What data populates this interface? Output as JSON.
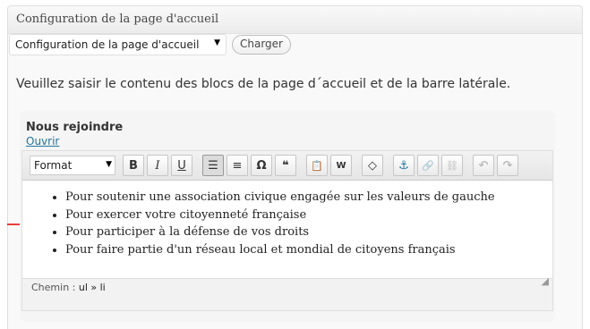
{
  "panel": {
    "title": "Configuration de la page d'accueil"
  },
  "loader": {
    "selected": "Configuration de la page d'accueil",
    "load_label": "Charger"
  },
  "intro_text": "Veuillez saisir le contenu des blocs de la page d´accueil et de la barre latérale.",
  "block": {
    "title": "Nous rejoindre",
    "open_link": "Ouvrir",
    "editor": {
      "format_label": "Format",
      "toolbar": [
        {
          "name": "bold",
          "glyph": "B"
        },
        {
          "name": "italic",
          "glyph": "I"
        },
        {
          "name": "underline",
          "glyph": "U"
        },
        {
          "name": "bullet-list",
          "glyph": "☰"
        },
        {
          "name": "numbered-list",
          "glyph": "≡"
        },
        {
          "name": "special-char",
          "glyph": "Ω"
        },
        {
          "name": "blockquote",
          "glyph": "❝"
        },
        {
          "name": "paste-text",
          "glyph": "📋"
        },
        {
          "name": "paste-word",
          "glyph": "W"
        },
        {
          "name": "remove-format",
          "glyph": "◇"
        },
        {
          "name": "anchor",
          "glyph": "⚓"
        },
        {
          "name": "link",
          "glyph": "🔗"
        },
        {
          "name": "unlink",
          "glyph": "⛓"
        },
        {
          "name": "undo",
          "glyph": "↶"
        },
        {
          "name": "redo",
          "glyph": "↷"
        }
      ],
      "items": [
        "Pour soutenir une association civique engagée sur les valeurs de gauche",
        "Pour exercer votre citoyenneté française",
        "Pour participer à la défense de vos droits",
        "Pour faire partie d'un réseau local et mondial de citoyens français"
      ],
      "status_prefix": "Chemin :",
      "status_path": "ul » li"
    }
  },
  "colors": {
    "link": "#21759b",
    "arrow": "#e00000"
  }
}
